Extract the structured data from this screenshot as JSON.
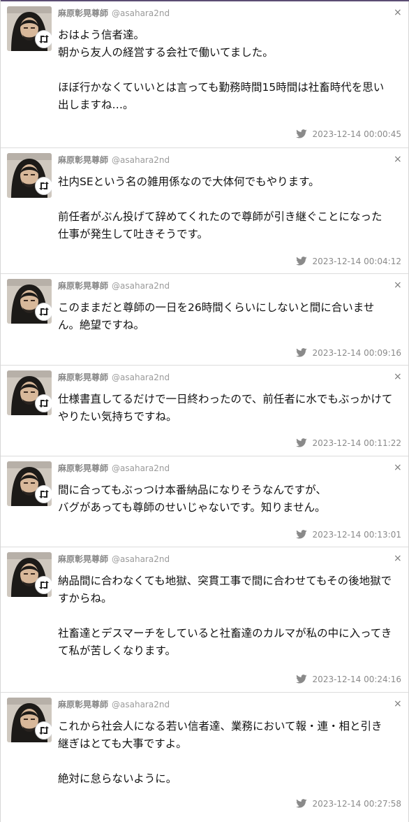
{
  "tweets": [
    {
      "name": "麻原彰晃尊師",
      "handle": "@asahara2nd",
      "paragraphs": [
        "おはよう信者達。\n朝から友人の経営する会社で働いてました。",
        "ほぼ行かなくていいとは言っても勤務時間15時間は社畜時代を思い出しますね…。"
      ],
      "timestamp": "2023-12-14 00:00:45"
    },
    {
      "name": "麻原彰晃尊師",
      "handle": "@asahara2nd",
      "paragraphs": [
        "社内SEという名の雑用係なので大体何でもやります。",
        "前任者がぶん投げて辞めてくれたので尊師が引き継ぐことになった仕事が発生して吐きそうです。"
      ],
      "timestamp": "2023-12-14 00:04:12"
    },
    {
      "name": "麻原彰晃尊師",
      "handle": "@asahara2nd",
      "paragraphs": [
        "このままだと尊師の一日を26時間くらいにしないと間に合いません。絶望ですね。"
      ],
      "timestamp": "2023-12-14 00:09:16"
    },
    {
      "name": "麻原彰晃尊師",
      "handle": "@asahara2nd",
      "paragraphs": [
        "仕様書直してるだけで一日終わったので、前任者に水でもぶっかけてやりたい気持ちですね。"
      ],
      "timestamp": "2023-12-14 00:11:22"
    },
    {
      "name": "麻原彰晃尊師",
      "handle": "@asahara2nd",
      "paragraphs": [
        "間に合ってもぶっつけ本番納品になりそうなんですが、\nバグがあっても尊師のせいじゃないです。知りません。"
      ],
      "timestamp": "2023-12-14 00:13:01"
    },
    {
      "name": "麻原彰晃尊師",
      "handle": "@asahara2nd",
      "paragraphs": [
        "納品間に合わなくても地獄、突貫工事で間に合わせてもその後地獄ですからね。",
        "社畜達とデスマーチをしていると社畜達のカルマが私の中に入ってきて私が苦しくなります。"
      ],
      "timestamp": "2023-12-14 00:24:16"
    },
    {
      "name": "麻原彰晃尊師",
      "handle": "@asahara2nd",
      "paragraphs": [
        "これから社会人になる若い信者達、業務において報・連・相と引き継ぎはとても大事ですよ。",
        "絶対に怠らないように。"
      ],
      "timestamp": "2023-12-14 00:27:58"
    }
  ],
  "icons": {
    "close": "×",
    "retweet": "retweet-icon",
    "bird": "twitter-bird-icon"
  },
  "colors": {
    "top_bar": "#5b4c72",
    "divider": "#dcdcdc",
    "meta_text": "#8a8a8a"
  }
}
